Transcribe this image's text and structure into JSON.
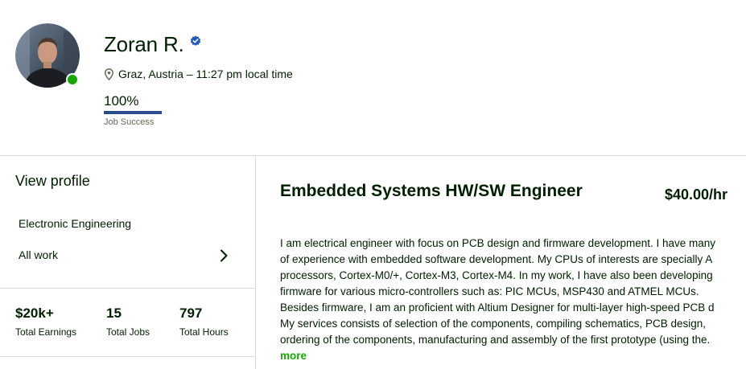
{
  "profile": {
    "name": "Zoran R.",
    "location": "Graz, Austria – 11:27 pm local time",
    "job_success": {
      "value_label": "100%",
      "value": 100,
      "label": "Job Success"
    }
  },
  "sidebar": {
    "view_profile": "View profile",
    "items": [
      {
        "label": "Electronic Engineering"
      },
      {
        "label": "All work"
      }
    ],
    "stats": [
      {
        "value": "$20k+",
        "label": "Total Earnings"
      },
      {
        "value": "15",
        "label": "Total Jobs"
      },
      {
        "value": "797",
        "label": "Total Hours"
      }
    ]
  },
  "main": {
    "title": "Embedded Systems HW/SW Engineer",
    "rate": "$40.00/hr",
    "description_lines": [
      "I am electrical engineer with focus on PCB design and firmware development. I have many",
      "of experience with embedded software development. My CPUs of interests are specially A",
      "processors, Cortex-M0/+, Cortex-M3, Cortex-M4. In my work, I have also been developing",
      "firmware for various micro-controllers such as: PIC MCUs, MSP430 and ATMEL MCUs.",
      "Besides firmware, I am an proficient with Altium Designer for multi-layer high-speed PCB d",
      "My services consists of selection of the components, compiling schematics, PCB design,",
      "ordering of the components, manufacturing and assembly of the first prototype (using the."
    ],
    "more_label": "more"
  },
  "colors": {
    "online": "#14a800",
    "verified": "#1f57c3",
    "link": "#14a800",
    "text": "#001e00",
    "divider": "#d5e0d5"
  },
  "icons": {
    "verified": "verified-badge-icon",
    "location": "location-pin-icon",
    "chevron": "chevron-right-icon"
  }
}
